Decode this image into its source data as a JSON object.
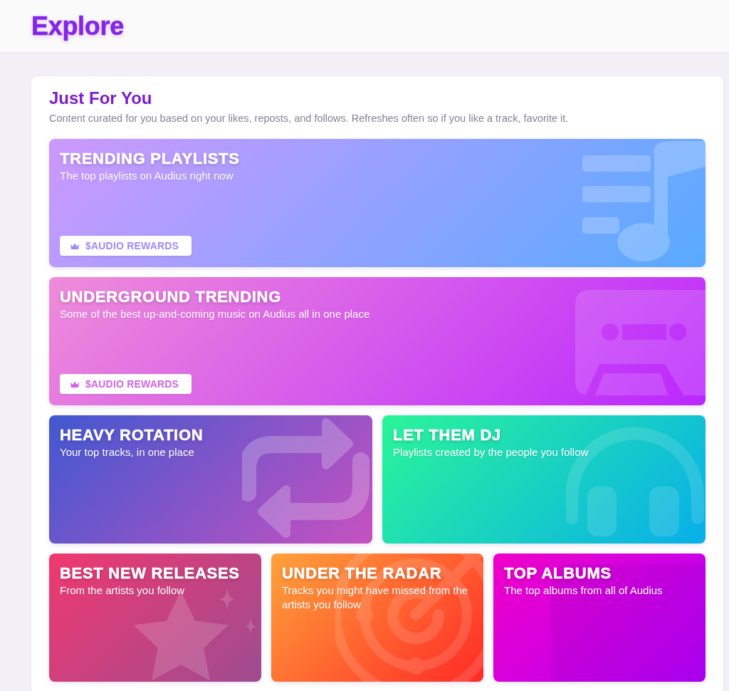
{
  "header": {
    "title": "Explore"
  },
  "section": {
    "title": "Just For You",
    "description": "Content curated for you based on your likes, reposts, and follows. Refreshes often so if you like a track, favorite it."
  },
  "rows": [
    {
      "tiles": [
        {
          "title": "TRENDING PLAYLISTS",
          "description": "The top playlists on Audius right now",
          "button": "$AUDIO REWARDS"
        }
      ]
    },
    {
      "tiles": [
        {
          "title": "UNDERGROUND TRENDING",
          "description": "Some of the best up-and-coming music on Audius all in one place",
          "button": "$AUDIO REWARDS"
        }
      ]
    },
    {
      "tiles": [
        {
          "title": "HEAVY ROTATION",
          "description": "Your top tracks, in one place"
        },
        {
          "title": "LET THEM DJ",
          "description": "Playlists created by the people you follow"
        }
      ]
    },
    {
      "tiles": [
        {
          "title": "BEST NEW RELEASES",
          "description": "From the artists you follow"
        },
        {
          "title": "UNDER THE RADAR",
          "description": "Tracks you might have missed from the artists you follow"
        },
        {
          "title": "TOP ALBUMS",
          "description": "The top albums from all of Audius"
        }
      ]
    }
  ]
}
